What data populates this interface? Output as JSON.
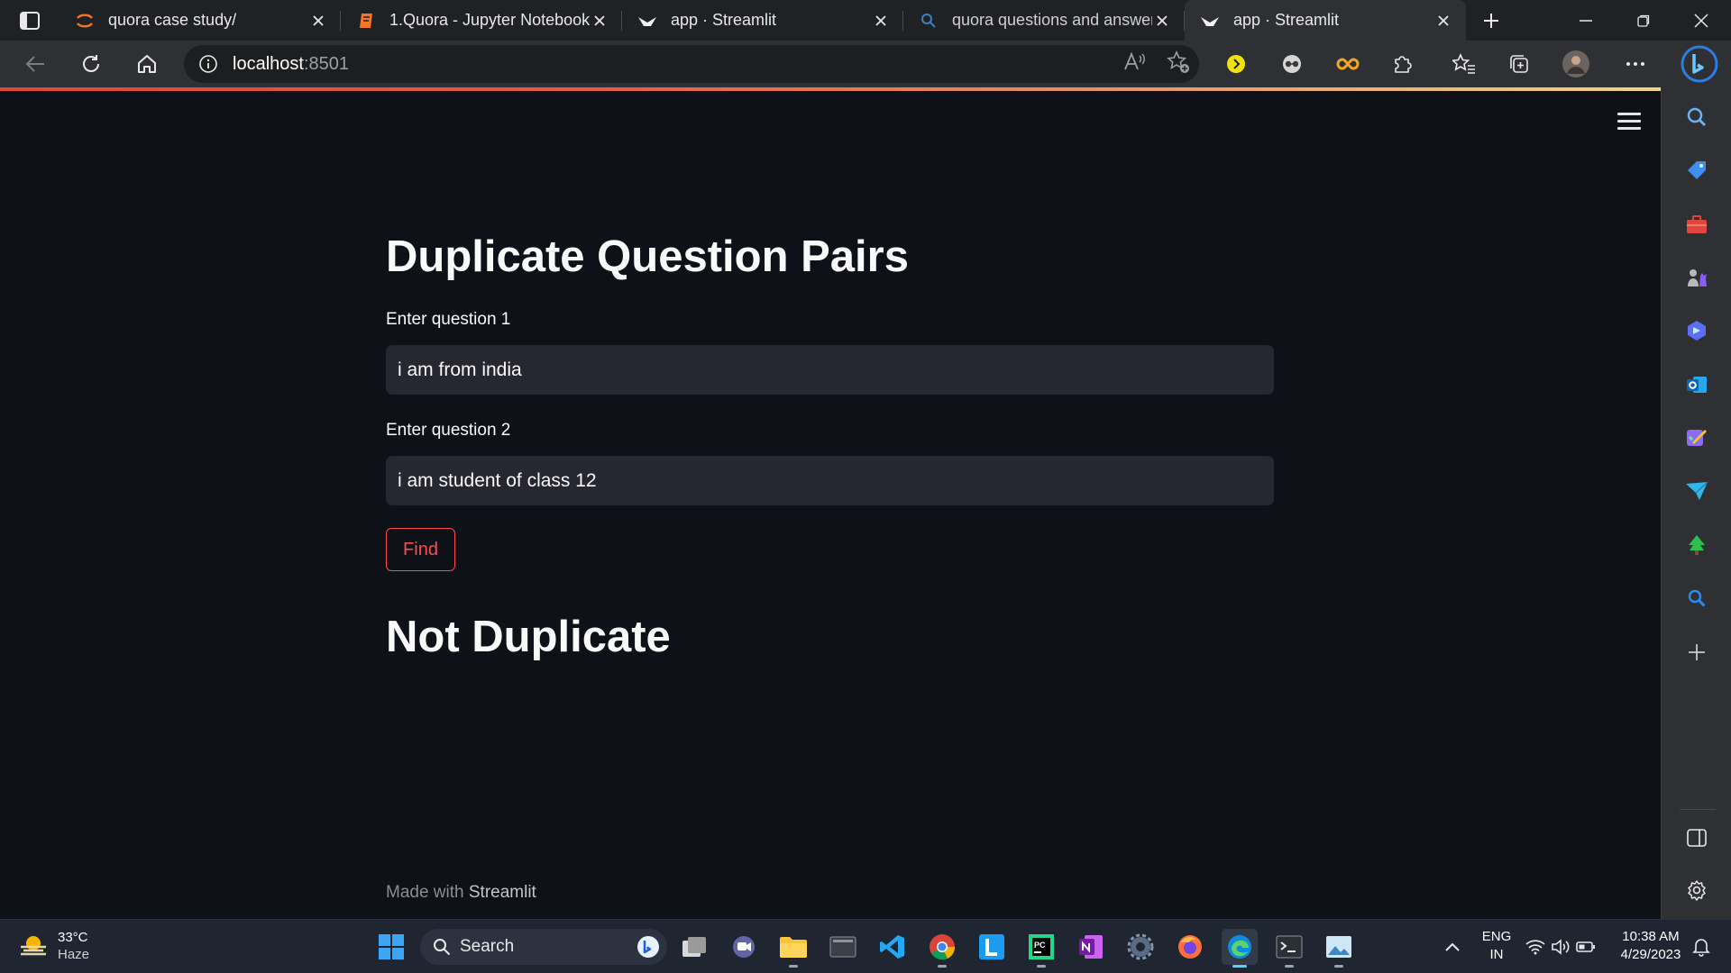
{
  "browser": {
    "tabs": [
      {
        "title": "quora case study/",
        "icon": "jupyter-icon"
      },
      {
        "title": "1.Quora - Jupyter Notebook",
        "icon": "notebook-icon"
      },
      {
        "title": "app · Streamlit",
        "icon": "streamlit-icon"
      },
      {
        "title": "quora questions and answers",
        "icon": "search-icon"
      },
      {
        "title": "app · Streamlit",
        "icon": "streamlit-icon",
        "active": true
      }
    ],
    "address": {
      "host": "localhost",
      "port": ":8501"
    }
  },
  "app": {
    "title": "Duplicate Question Pairs",
    "question1": {
      "label": "Enter question 1",
      "value": "i am from india"
    },
    "question2": {
      "label": "Enter question 2",
      "value": "i am student of class 12"
    },
    "find_button": "Find",
    "result": "Not Duplicate",
    "footer": {
      "prefix": "Made with ",
      "brand": "Streamlit"
    },
    "accent_color": "#ff4b4b",
    "background_color": "#0e1117"
  },
  "taskbar": {
    "weather": {
      "temp": "33°C",
      "condition": "Haze"
    },
    "search_label": "Search",
    "language": {
      "lang": "ENG",
      "region": "IN"
    },
    "clock": {
      "time": "10:38 AM",
      "date": "4/29/2023"
    }
  }
}
